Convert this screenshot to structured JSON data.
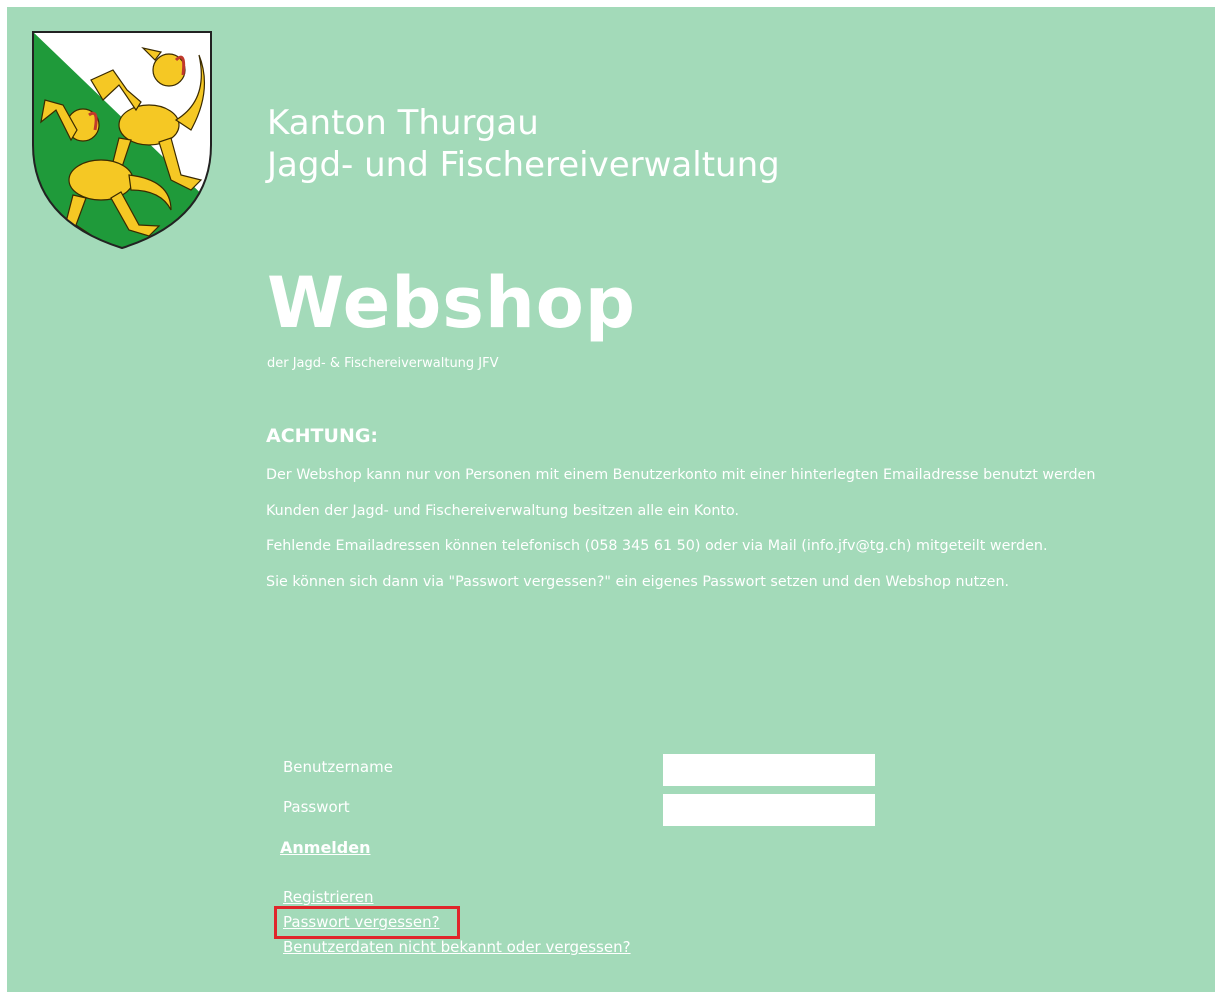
{
  "header": {
    "org_line1": "Kanton Thurgau",
    "org_line2": "Jagd- und Fischereiverwaltung",
    "crest_icon": "thurgau-coat-of-arms-icon"
  },
  "shop": {
    "title": "Webshop",
    "subtitle": "der Jagd- & Fischereiverwaltung JFV"
  },
  "notice": {
    "heading": "ACHTUNG:",
    "lines": [
      "Der Webshop kann nur von Personen mit einem Benutzerkonto mit einer hinterlegten Emailadresse benutzt werden",
      "Kunden der Jagd- und Fischereiverwaltung besitzen alle ein Konto.",
      "Fehlende Emailadressen können telefonisch (058 345 61 50) oder via Mail (info.jfv@tg.ch) mitgeteilt werden.",
      "Sie können sich dann via \"Passwort vergessen?\" ein eigenes Passwort setzen und den Webshop nutzen."
    ]
  },
  "login": {
    "username_label": "Benutzername",
    "username_value": "",
    "password_label": "Passwort",
    "password_value": "",
    "submit_label": "Anmelden"
  },
  "links": {
    "register": "Registrieren",
    "forgot_password": "Passwort vergessen?",
    "unknown_credentials": "Benutzerdaten nicht bekannt oder vergessen?"
  },
  "colors": {
    "background": "#a3dab9",
    "text": "#ffffff",
    "highlight": "#e0262b",
    "crest_green": "#1f9a3a",
    "crest_gold": "#f5c824"
  }
}
